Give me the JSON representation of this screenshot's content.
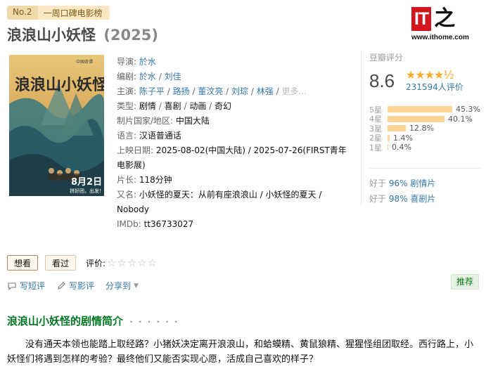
{
  "rank": {
    "no": "No.2",
    "list_name": "一周口碑电影榜"
  },
  "movie": {
    "title": "浪浪山小妖怪",
    "year": "(2025)"
  },
  "logo": {
    "it": "IT",
    "zhi": "之",
    "url": "www.ithome.com"
  },
  "poster": {
    "title_text": "浪浪山小妖怪",
    "date_text": "8月2日",
    "slogan": "拼好团，出发！",
    "top_tag": "中国奇谭"
  },
  "info": {
    "director_label": "导演:",
    "director": "於水",
    "writer_label": "编剧:",
    "writers": [
      "於水",
      "刘佳"
    ],
    "cast_label": "主演:",
    "cast": [
      "陈子平",
      "路扬",
      "董汶亮",
      "刘琮",
      "林强"
    ],
    "cast_more": "更多...",
    "genre_label": "类型:",
    "genres": [
      "剧情",
      "喜剧",
      "动画",
      "奇幻"
    ],
    "country_label": "制片国家/地区:",
    "country": "中国大陆",
    "language_label": "语言:",
    "language": "汉语普通话",
    "release_label": "上映日期:",
    "release": "2025-08-02(中国大陆) / 2025-07-26(FIRST青年电影展)",
    "runtime_label": "片长:",
    "runtime": "118分钟",
    "aka_label": "又名:",
    "aka": "小妖怪的夏天：从前有座浪浪山 / 小妖怪的夏天 / Nobody",
    "imdb_label": "IMDb:",
    "imdb": "tt36733027"
  },
  "rating": {
    "title": "豆瓣评分",
    "score": "8.6",
    "stars": "★★★★½",
    "votes": "231594人评价",
    "distribution": [
      {
        "label": "5星",
        "pct_text": "45.3%",
        "pct": 45.3
      },
      {
        "label": "4星",
        "pct_text": "40.1%",
        "pct": 40.1
      },
      {
        "label": "3星",
        "pct_text": "12.8%",
        "pct": 12.8
      },
      {
        "label": "2星",
        "pct_text": "1.4%",
        "pct": 1.4
      },
      {
        "label": "1星",
        "pct_text": "0.4%",
        "pct": 0.4
      }
    ],
    "better_prefix_1": "好于",
    "better_link_1": "96% 剧情片",
    "better_prefix_2": "好于",
    "better_link_2": "98% 喜剧片"
  },
  "actions": {
    "want": "想看",
    "seen": "看过",
    "rate_label": "评价:",
    "empty_stars": "☆☆☆☆☆"
  },
  "tools": {
    "short_review": "写短评",
    "review": "写影评",
    "share": "分享到"
  },
  "recommend": "推荐",
  "section": {
    "title": "浪浪山小妖怪的剧情简介",
    "dots": "· · · · · ·"
  },
  "summary": "没有通天本领也能踏上取经路？小猪妖决定离开浪浪山，和蛤蟆精、黄鼠狼精、猩猩怪组团取经。西行路上，小妖怪们将遇到怎样的考验？最终他们又能否实现心愿，活成自己喜欢的样子？",
  "colors": {
    "link": "#3377aa",
    "star": "#ffac2d",
    "bar": "#ffd596",
    "section": "#007722",
    "logo_red": "#d2161e"
  }
}
